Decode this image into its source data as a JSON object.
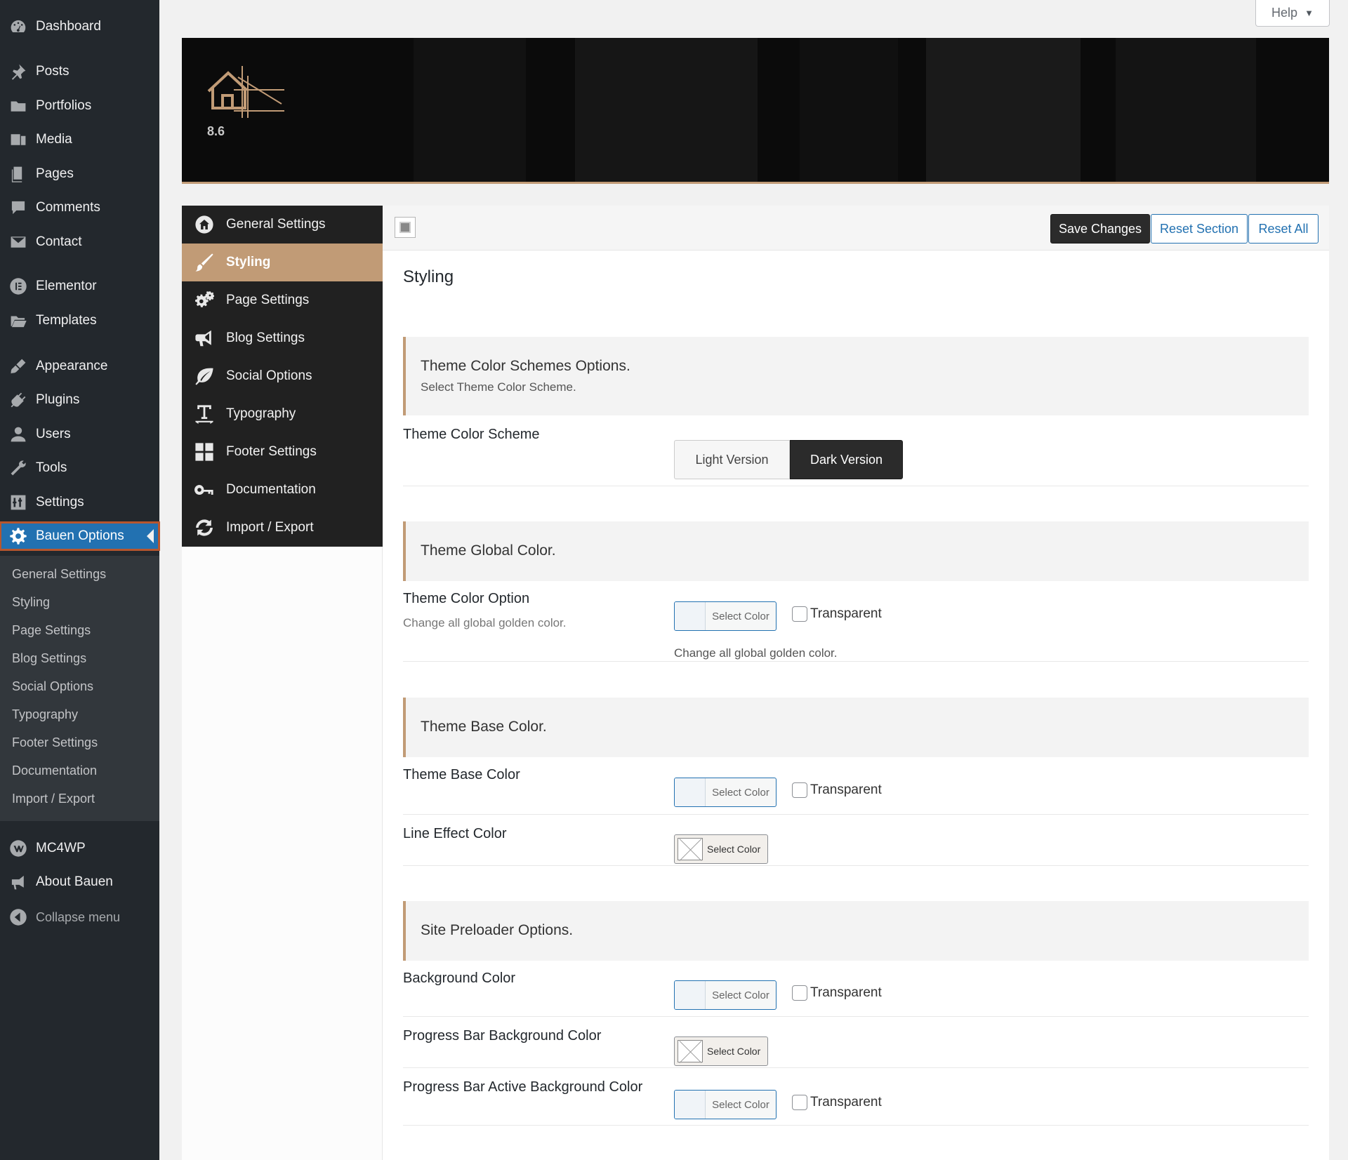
{
  "admin_menu": {
    "items": [
      {
        "label": "Dashboard",
        "icon": "dashboard-icon"
      },
      {
        "label": "Posts",
        "icon": "pushpin-icon"
      },
      {
        "label": "Portfolios",
        "icon": "folder-icon"
      },
      {
        "label": "Media",
        "icon": "media-icon"
      },
      {
        "label": "Pages",
        "icon": "pages-icon"
      },
      {
        "label": "Comments",
        "icon": "comment-icon"
      },
      {
        "label": "Contact",
        "icon": "mail-icon"
      },
      {
        "label": "Elementor",
        "icon": "elementor-icon"
      },
      {
        "label": "Templates",
        "icon": "folder-open-icon"
      },
      {
        "label": "Appearance",
        "icon": "paintbrush-icon"
      },
      {
        "label": "Plugins",
        "icon": "plugin-icon"
      },
      {
        "label": "Users",
        "icon": "user-icon"
      },
      {
        "label": "Tools",
        "icon": "wrench-icon"
      },
      {
        "label": "Settings",
        "icon": "settings-sliders-icon"
      },
      {
        "label": "Bauen Options",
        "icon": "gear-icon"
      },
      {
        "label": "MC4WP",
        "icon": "mc4wp-icon"
      },
      {
        "label": "About Bauen",
        "icon": "megaphone-icon"
      },
      {
        "label": "Collapse menu",
        "icon": "collapse-arrow-icon"
      }
    ],
    "submenu": [
      "General Settings",
      "Styling",
      "Page Settings",
      "Blog Settings",
      "Social Options",
      "Typography",
      "Footer Settings",
      "Documentation",
      "Import / Export"
    ]
  },
  "help": {
    "label": "Help"
  },
  "banner": {
    "version": "8.6",
    "accent": "#c19b76"
  },
  "options_nav": [
    {
      "label": "General Settings",
      "icon": "home-icon"
    },
    {
      "label": "Styling",
      "icon": "brush-icon"
    },
    {
      "label": "Page Settings",
      "icon": "cogs-icon"
    },
    {
      "label": "Blog Settings",
      "icon": "bullhorn-icon"
    },
    {
      "label": "Social Options",
      "icon": "leaf-icon"
    },
    {
      "label": "Typography",
      "icon": "text-height-icon"
    },
    {
      "label": "Footer Settings",
      "icon": "grid-icon"
    },
    {
      "label": "Documentation",
      "icon": "key-icon"
    },
    {
      "label": "Import / Export",
      "icon": "refresh-icon"
    }
  ],
  "toolbar": {
    "save": "Save Changes",
    "reset_section": "Reset Section",
    "reset_all": "Reset All"
  },
  "main": {
    "heading": "Styling",
    "scheme_section": {
      "title": "Theme Color Schemes Options.",
      "desc": "Select Theme Color Scheme."
    },
    "scheme_field": {
      "label": "Theme Color Scheme",
      "light": "Light Version",
      "dark": "Dark Version",
      "selected": "Dark Version"
    },
    "global_section": {
      "title": "Theme Global Color."
    },
    "color_option": {
      "label": "Theme Color Option",
      "sub": "Change all global golden color.",
      "desc": "Change all global golden color."
    },
    "base_section": {
      "title": "Theme Base Color."
    },
    "base_color": {
      "label": "Theme Base Color"
    },
    "line_effect": {
      "label": "Line Effect Color"
    },
    "preloader_section": {
      "title": "Site Preloader Options."
    },
    "bg_color": {
      "label": "Background Color"
    },
    "progress_bg": {
      "label": "Progress Bar Background Color"
    },
    "progress_active": {
      "label": "Progress Bar Active Background Color"
    },
    "select_color": "Select Color",
    "transparent": "Transparent"
  }
}
